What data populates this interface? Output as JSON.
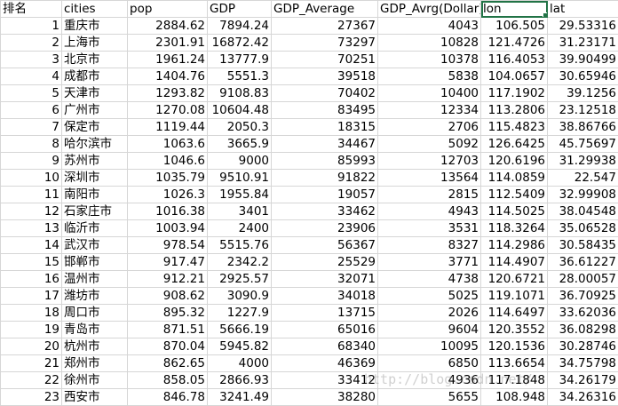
{
  "headers": [
    "排名",
    "cities",
    "pop",
    "GDP",
    "GDP_Average",
    "GDP_Avrg(Dollar)",
    "lon",
    "lat"
  ],
  "rows": [
    [
      "1",
      "重庆市",
      "2884.62",
      "7894.24",
      "27367",
      "4043",
      "106.505",
      "29.53316"
    ],
    [
      "2",
      "上海市",
      "2301.91",
      "16872.42",
      "73297",
      "10828",
      "121.4726",
      "31.23171"
    ],
    [
      "3",
      "北京市",
      "1961.24",
      "13777.9",
      "70251",
      "10378",
      "116.4053",
      "39.90499"
    ],
    [
      "4",
      "成都市",
      "1404.76",
      "5551.3",
      "39518",
      "5838",
      "104.0657",
      "30.65946"
    ],
    [
      "5",
      "天津市",
      "1293.82",
      "9108.83",
      "70402",
      "10400",
      "117.1902",
      "39.1256"
    ],
    [
      "6",
      "广州市",
      "1270.08",
      "10604.48",
      "83495",
      "12334",
      "113.2806",
      "23.12518"
    ],
    [
      "7",
      "保定市",
      "1119.44",
      "2050.3",
      "18315",
      "2706",
      "115.4823",
      "38.86766"
    ],
    [
      "8",
      "哈尔滨市",
      "1063.6",
      "3665.9",
      "34467",
      "5092",
      "126.6425",
      "45.75697"
    ],
    [
      "9",
      "苏州市",
      "1046.6",
      "9000",
      "85993",
      "12703",
      "120.6196",
      "31.29938"
    ],
    [
      "10",
      "深圳市",
      "1035.79",
      "9510.91",
      "91822",
      "13564",
      "114.0859",
      "22.547"
    ],
    [
      "11",
      "南阳市",
      "1026.3",
      "1955.84",
      "19057",
      "2815",
      "112.5409",
      "32.99908"
    ],
    [
      "12",
      "石家庄市",
      "1016.38",
      "3401",
      "33462",
      "4943",
      "114.5025",
      "38.04548"
    ],
    [
      "13",
      "临沂市",
      "1003.94",
      "2400",
      "23906",
      "3531",
      "118.3264",
      "35.06528"
    ],
    [
      "14",
      "武汉市",
      "978.54",
      "5515.76",
      "56367",
      "8327",
      "114.2986",
      "30.58435"
    ],
    [
      "15",
      "邯郸市",
      "917.47",
      "2342.2",
      "25529",
      "3771",
      "114.4907",
      "36.61227"
    ],
    [
      "16",
      "温州市",
      "912.21",
      "2925.57",
      "32071",
      "4738",
      "120.6721",
      "28.00057"
    ],
    [
      "17",
      "潍坊市",
      "908.62",
      "3090.9",
      "34018",
      "5025",
      "119.1071",
      "36.70925"
    ],
    [
      "18",
      "周口市",
      "895.32",
      "1227.9",
      "13715",
      "2026",
      "114.6497",
      "33.62036"
    ],
    [
      "19",
      "青岛市",
      "871.51",
      "5666.19",
      "65016",
      "9604",
      "120.3552",
      "36.08298"
    ],
    [
      "20",
      "杭州市",
      "870.04",
      "5945.82",
      "68340",
      "10095",
      "120.1536",
      "30.28746"
    ],
    [
      "21",
      "郑州市",
      "862.65",
      "4000",
      "46369",
      "6850",
      "113.6654",
      "34.75798"
    ],
    [
      "22",
      "徐州市",
      "858.05",
      "2866.93",
      "33412",
      "4936",
      "117.1848",
      "34.26179"
    ],
    [
      "23",
      "西安市",
      "846.78",
      "3241.49",
      "38280",
      "5655",
      "108.948",
      "34.26316"
    ]
  ],
  "watermark": "http://blog.csdn.net/"
}
